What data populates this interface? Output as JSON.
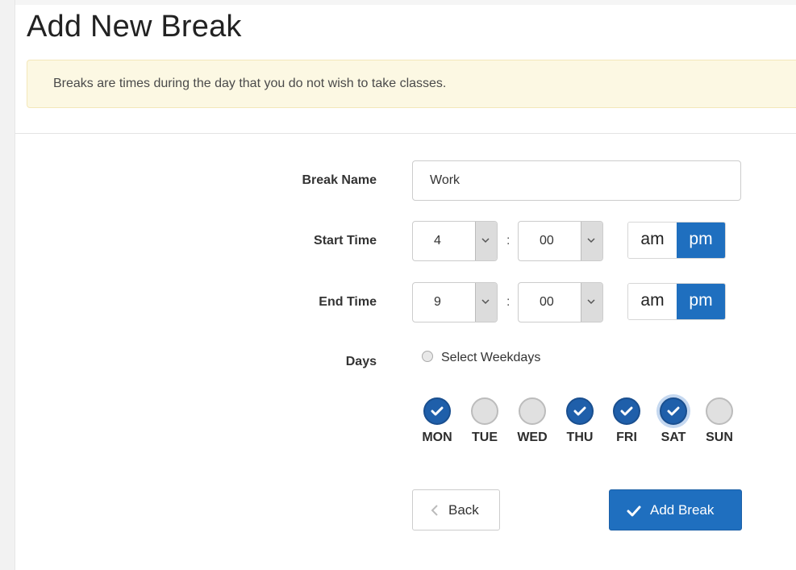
{
  "page": {
    "title": "Add New Break",
    "notice": "Breaks are times during the day that you do not wish to take classes."
  },
  "form": {
    "break_name": {
      "label": "Break Name",
      "value": "Work"
    },
    "start_time": {
      "label": "Start Time",
      "hour": "4",
      "minute": "00",
      "separator": ":",
      "am_label": "am",
      "pm_label": "pm",
      "selected": "pm"
    },
    "end_time": {
      "label": "End Time",
      "hour": "9",
      "minute": "00",
      "separator": ":",
      "am_label": "am",
      "pm_label": "pm",
      "selected": "pm"
    },
    "days": {
      "label": "Days",
      "select_weekdays_label": "Select Weekdays",
      "select_weekdays_checked": false,
      "items": [
        {
          "name": "MON",
          "checked": true
        },
        {
          "name": "TUE",
          "checked": false
        },
        {
          "name": "WED",
          "checked": false
        },
        {
          "name": "THU",
          "checked": true
        },
        {
          "name": "FRI",
          "checked": true
        },
        {
          "name": "SAT",
          "checked": true,
          "focused": true
        },
        {
          "name": "SUN",
          "checked": false
        }
      ]
    }
  },
  "actions": {
    "back_label": "Back",
    "add_label": "Add Break"
  },
  "colors": {
    "primary": "#1f6fbf",
    "checked_day": "#1f5faa",
    "notice_background": "#fcf8e3"
  },
  "icons": {
    "caret": "chevron-down-icon",
    "back": "chevron-left-icon",
    "add": "checkmark-icon",
    "day_checked": "checkmark-icon"
  }
}
